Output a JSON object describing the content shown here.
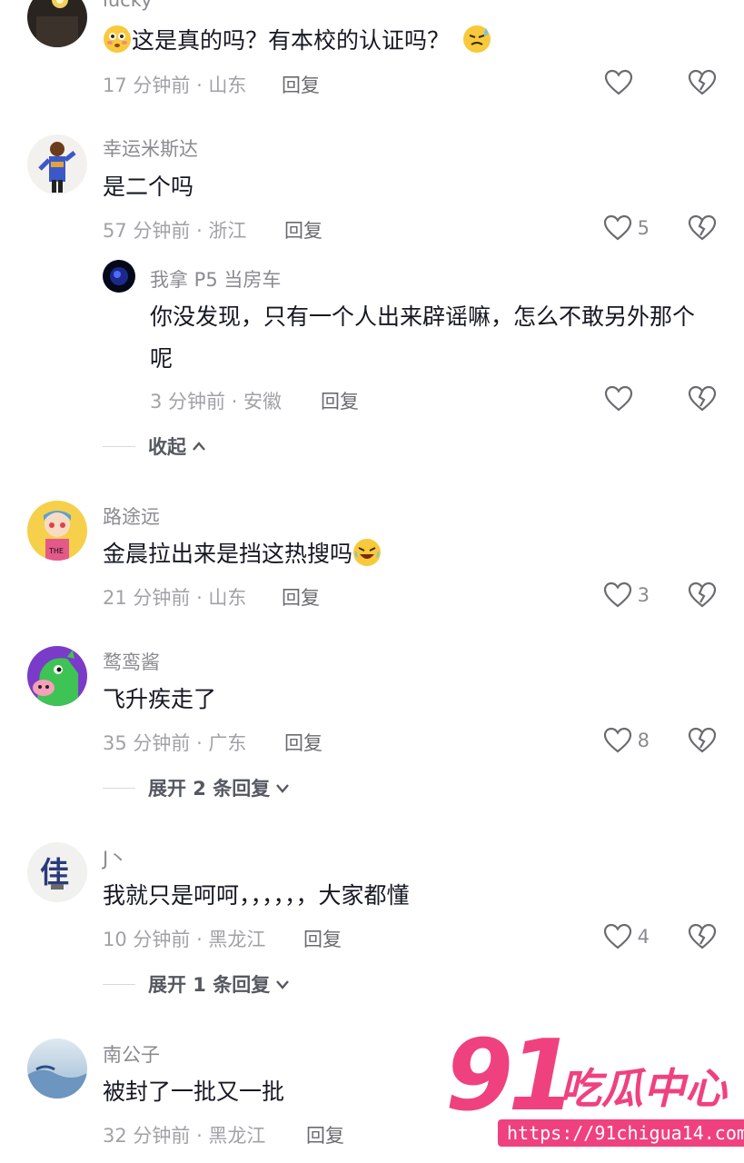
{
  "comments": [
    {
      "username": "lucky",
      "text": "这是真的吗？有本校的认证吗？",
      "time": "17 分钟前 · 山东",
      "reply_label": "回复",
      "likes": ""
    },
    {
      "username": "幸运米斯达",
      "text": "是二个吗",
      "time": "57 分钟前 · 浙江",
      "reply_label": "回复",
      "likes": "5",
      "replies": [
        {
          "username": "我拿 P5 当房车",
          "text": "你没发现，只有一个人出来辟谣嘛，怎么不敢另外那个呢",
          "time": "3 分钟前 · 安徽",
          "reply_label": "回复",
          "likes": ""
        }
      ],
      "toggle_label": "收起"
    },
    {
      "username": "路途远",
      "text": "金晨拉出来是挡这热搜吗",
      "time": "21 分钟前 · 山东",
      "reply_label": "回复",
      "likes": "3"
    },
    {
      "username": "鹜鸾酱",
      "text": "飞升疾走了",
      "time": "35 分钟前 · 广东",
      "reply_label": "回复",
      "likes": "8",
      "toggle_label": "展开 2 条回复"
    },
    {
      "username": "J丶",
      "text": "我就只是呵呵，，，，，，大家都懂",
      "time": "10 分钟前 · 黑龙江",
      "reply_label": "回复",
      "likes": "4",
      "toggle_label": "展开 1 条回复"
    },
    {
      "username": "南公子",
      "text": "被封了一批又一批",
      "time": "32 分钟前 · 黑龙江",
      "reply_label": "回复",
      "likes": ""
    }
  ],
  "watermark": {
    "number": "91",
    "name": "吃瓜中心",
    "url": "https://91chigua14.com"
  },
  "colors": {
    "brand": "#f0417f",
    "username": "#8a8b91",
    "meta": "#a1a2a7",
    "text": "#161823"
  }
}
